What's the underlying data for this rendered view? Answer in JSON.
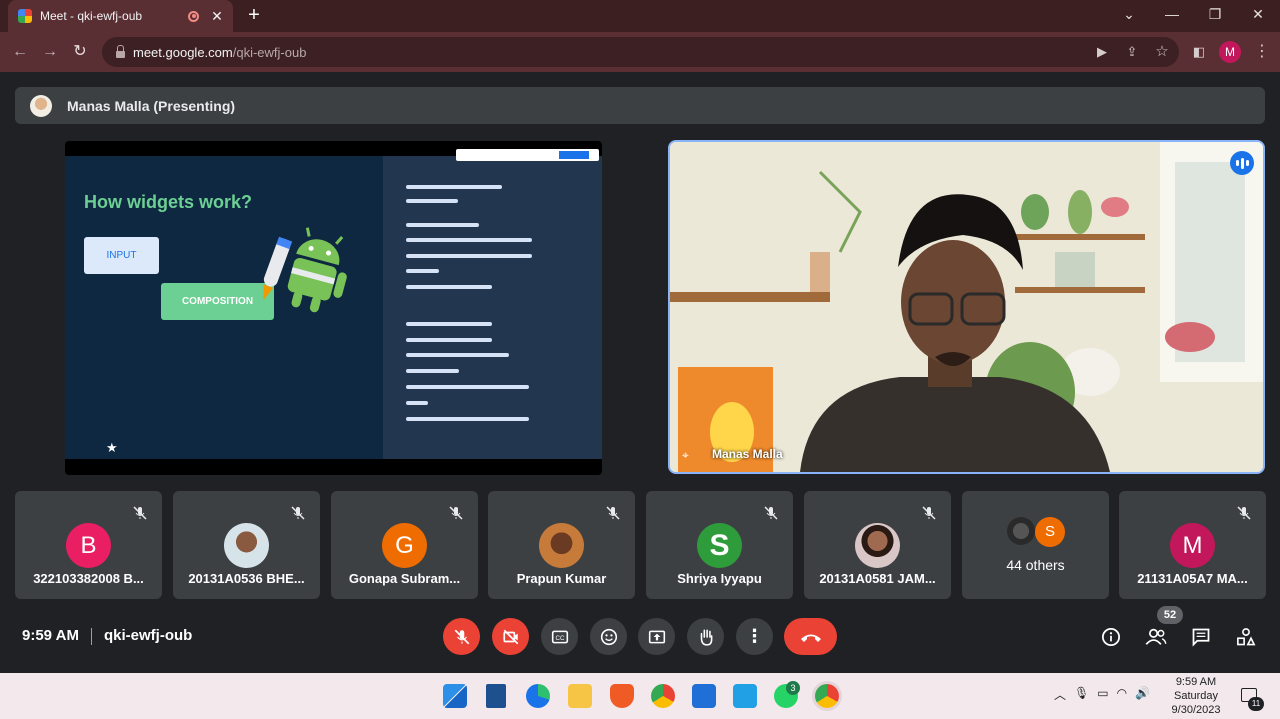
{
  "browser": {
    "tab_title": "Meet - qki-ewfj-oub",
    "url_host": "meet.google.com",
    "url_path": "/qki-ewfj-oub",
    "profile_initial": "M"
  },
  "presenter": {
    "label": "Manas Malla (Presenting)"
  },
  "slide": {
    "title": "How widgets work?",
    "input_label": "INPUT",
    "composition_label": "COMPOSITION"
  },
  "video": {
    "name": "Manas Malla"
  },
  "participants": [
    {
      "name": "322103382008 B...",
      "initial": "B",
      "color": "#e91e63"
    },
    {
      "name": "20131A0536 BHE...",
      "initial": "",
      "color": "#d6e4ea"
    },
    {
      "name": "Gonapa Subram...",
      "initial": "G",
      "color": "#ef6c00"
    },
    {
      "name": "Prapun Kumar",
      "initial": "",
      "color": "#c77b3b"
    },
    {
      "name": "Shriya Iyyapu",
      "initial": "S",
      "color": "#2e9c3a"
    },
    {
      "name": "20131A0581 JAM...",
      "initial": "",
      "color": "#d9c6c6"
    },
    {
      "name": "44 others",
      "initial": "S",
      "color": "#ef6c00"
    },
    {
      "name": "21131A05A7 MA...",
      "initial": "M",
      "color": "#c2185b"
    }
  ],
  "bottom": {
    "time": "9:59 AM",
    "meeting_code": "qki-ewfj-oub",
    "participant_count": "52"
  },
  "taskbar": {
    "time": "9:59 AM",
    "day": "Saturday",
    "date": "9/30/2023",
    "whatsapp_badge": "3",
    "notifications": "11"
  }
}
